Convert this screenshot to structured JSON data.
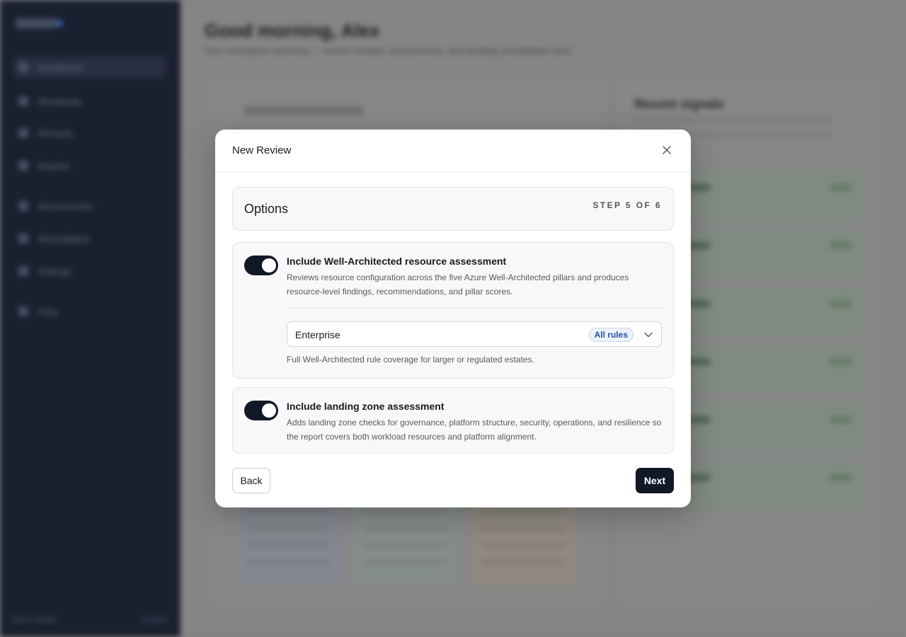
{
  "background": {
    "greeting": "Good morning, Alex",
    "greeting_sub": "Your workspace summary — recent reviews, assessments, and pending remediation work.",
    "sidebar_items": [
      "Dashboard",
      "Workloads",
      "Reviews",
      "Reports",
      "Assessments",
      "Remediation",
      "Settings",
      "Help"
    ],
    "sidebar_footer": "Alex Lander",
    "right_panel_title": "Recent signals"
  },
  "modal": {
    "title": "New Review",
    "close_icon": "close-icon"
  },
  "step": {
    "title": "Options",
    "counter": "STEP 5 OF 6"
  },
  "options": [
    {
      "title": "Include Well-Architected resource assessment",
      "description": "Reviews resource configuration across the five Azure Well-Architected pillars and produces resource-level findings, recommendations, and pillar scores.",
      "enabled": true,
      "ruleset": {
        "value": "Enterprise",
        "badge": "All rules",
        "help": "Full Well-Architected rule coverage for larger or regulated estates.",
        "icon": "chevron-down-icon"
      }
    },
    {
      "title": "Include landing zone assessment",
      "description": "Adds landing zone checks for governance, platform structure, security, operations, and resilience so the report covers both workload resources and platform alignment.",
      "enabled": true
    }
  ],
  "footer": {
    "back_label": "Back",
    "next_label": "Next"
  },
  "colors": {
    "primary": "#111827",
    "badge_text": "#2350a8",
    "badge_bg": "#eef3fb"
  }
}
